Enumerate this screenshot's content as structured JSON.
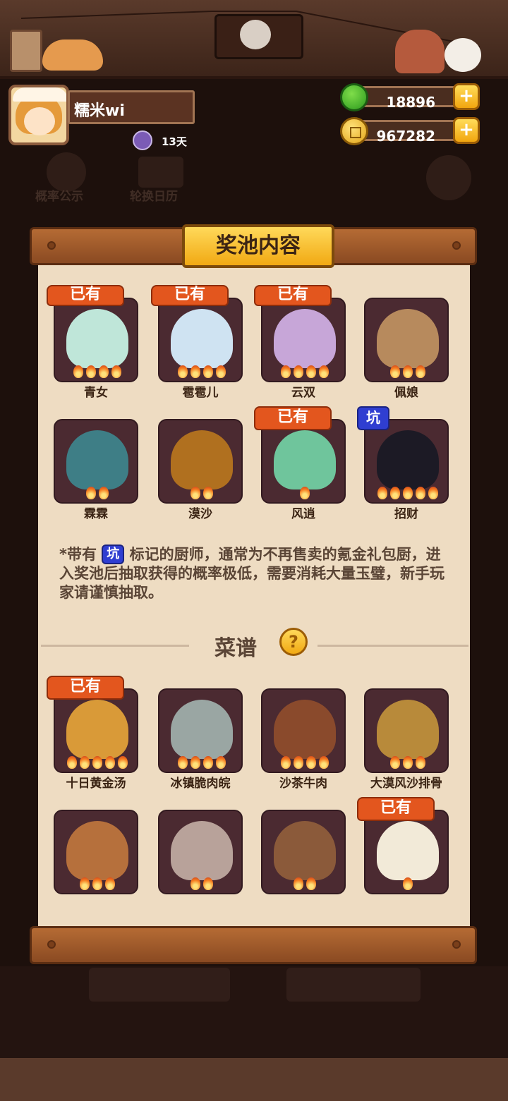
{
  "user": {
    "name": "糯米wi",
    "title_days": "13天"
  },
  "currency": {
    "jade": "18896",
    "coins": "967282",
    "plus": "+"
  },
  "background": {
    "probability_label": "概率公示",
    "calendar_label": "轮换日历"
  },
  "modal": {
    "title": "奖池内容",
    "owned_label": "已有",
    "pit_label": "坑",
    "chefs": [
      {
        "name": "青女",
        "stars": 4,
        "owned": true
      },
      {
        "name": "雹雹儿",
        "stars": 4,
        "owned": true
      },
      {
        "name": "云双",
        "stars": 4,
        "owned": true
      },
      {
        "name": "佩娘",
        "stars": 3,
        "owned": false
      },
      {
        "name": "霖霖",
        "stars": 2,
        "owned": false
      },
      {
        "name": "漠沙",
        "stars": 2,
        "owned": false
      },
      {
        "name": "风逍",
        "stars": 1,
        "owned": true
      },
      {
        "name": "招财",
        "stars": 5,
        "pit": true
      }
    ],
    "note": {
      "prefix": "*带有",
      "suffix": "标记的厨师，通常为不再售卖的氪金礼包厨，进入奖池后抽取获得的概率极低，需要消耗大量玉璧，新手玩家请谨慎抽取。"
    },
    "recipes_title": "菜谱",
    "recipes": [
      {
        "name": "十日黄金汤",
        "stars": 5,
        "owned": true
      },
      {
        "name": "冰镇脆肉皖",
        "stars": 4,
        "owned": false
      },
      {
        "name": "沙茶牛肉",
        "stars": 4,
        "owned": false
      },
      {
        "name": "大漠风沙排骨",
        "stars": 3,
        "owned": false
      },
      {
        "name": "",
        "stars": 3,
        "owned": false
      },
      {
        "name": "",
        "stars": 2,
        "owned": false
      },
      {
        "name": "",
        "stars": 2,
        "owned": false
      },
      {
        "name": "",
        "stars": 1,
        "owned": true
      }
    ]
  },
  "colors": {
    "owned": "#e3561e",
    "pit": "#2f3ed1",
    "panel": "#eedcc2",
    "tile": "#4b2a31"
  }
}
